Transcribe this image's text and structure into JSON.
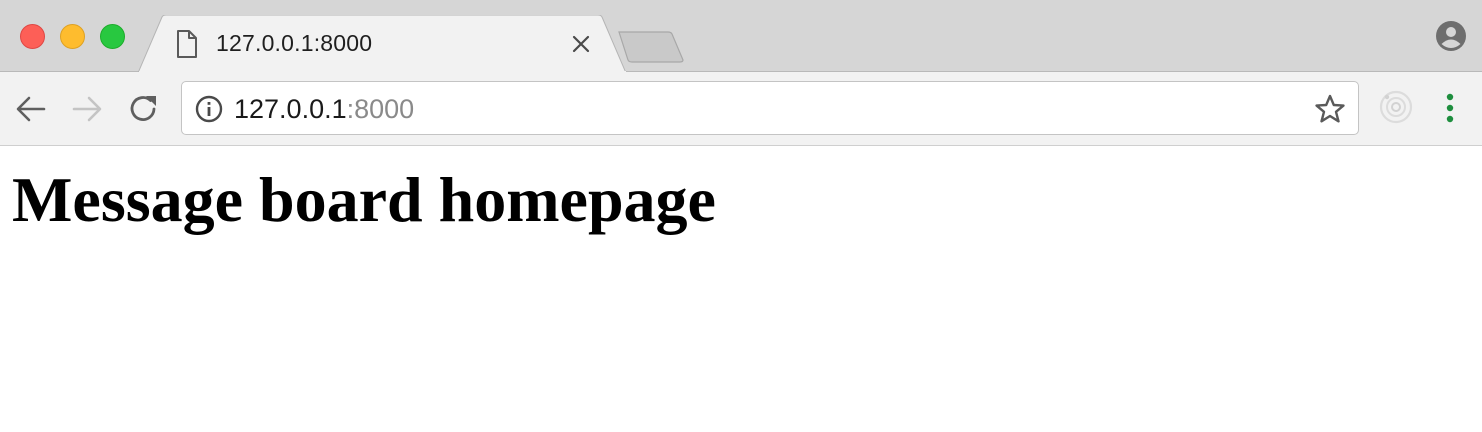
{
  "window": {
    "controls": [
      "close",
      "minimize",
      "maximize"
    ]
  },
  "tabs": [
    {
      "title": "127.0.0.1:8000",
      "icon": "document-icon",
      "active": true
    }
  ],
  "toolbar": {
    "back_icon": "arrow-left-icon",
    "forward_icon": "arrow-right-icon",
    "forward_enabled": false,
    "reload_icon": "reload-icon"
  },
  "address_bar": {
    "security_icon": "info-icon",
    "url_host": "127.0.0.1",
    "url_port": ":8000",
    "bookmark_icon": "star-icon"
  },
  "page": {
    "heading": "Message board homepage"
  },
  "colors": {
    "close": "#fd5f57",
    "minimize": "#febc2e",
    "maximize": "#28c840",
    "menu_dots": "#1e8e3e"
  }
}
